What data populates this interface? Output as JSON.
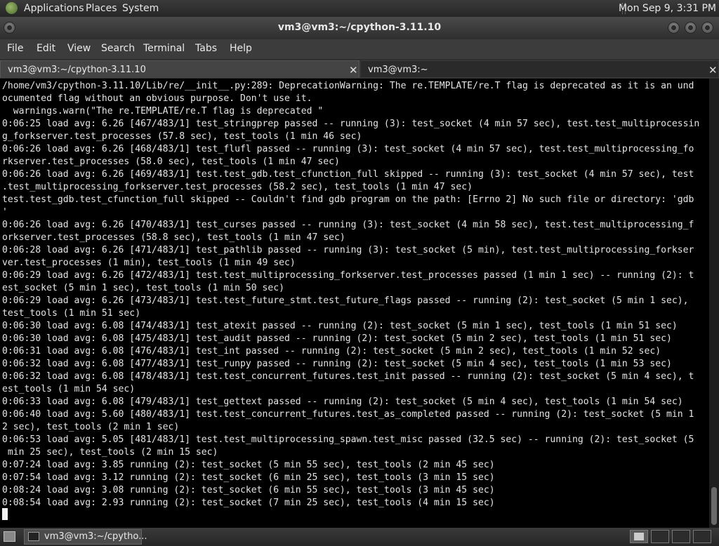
{
  "top_panel": {
    "menus": [
      "Applications",
      "Places",
      "System"
    ],
    "clock": "Mon Sep  9,  3:31 PM"
  },
  "window": {
    "title": "vm3@vm3:~/cpython-3.11.10"
  },
  "menubar": [
    "File",
    "Edit",
    "View",
    "Search",
    "Terminal",
    "Tabs",
    "Help"
  ],
  "tabs": [
    {
      "label": "vm3@vm3:~/cpython-3.11.10",
      "close": "✕"
    },
    {
      "label": "vm3@vm3:~",
      "close": "✕"
    }
  ],
  "terminal": {
    "lines": [
      "/home/vm3/cpython-3.11.10/Lib/re/__init__.py:289: DeprecationWarning: The re.TEMPLATE/re.T flag is deprecated as it is an und",
      "ocumented flag without an obvious purpose. Don't use it.",
      "  warnings.warn(\"The re.TEMPLATE/re.T flag is deprecated \"",
      "0:06:25 load avg: 6.26 [467/483/1] test_stringprep passed -- running (3): test_socket (4 min 57 sec), test.test_multiprocessin",
      "g_forkserver.test_processes (57.8 sec), test_tools (1 min 46 sec)",
      "0:06:26 load avg: 6.26 [468/483/1] test_flufl passed -- running (3): test_socket (4 min 57 sec), test.test_multiprocessing_fo",
      "rkserver.test_processes (58.0 sec), test_tools (1 min 47 sec)",
      "0:06:26 load avg: 6.26 [469/483/1] test.test_gdb.test_cfunction_full skipped -- running (3): test_socket (4 min 57 sec), test",
      ".test_multiprocessing_forkserver.test_processes (58.2 sec), test_tools (1 min 47 sec)",
      "test.test_gdb.test_cfunction_full skipped -- Couldn't find gdb program on the path: [Errno 2] No such file or directory: 'gdb",
      "'",
      "0:06:26 load avg: 6.26 [470/483/1] test_curses passed -- running (3): test_socket (4 min 58 sec), test.test_multiprocessing_f",
      "orkserver.test_processes (58.8 sec), test_tools (1 min 47 sec)",
      "0:06:28 load avg: 6.26 [471/483/1] test_pathlib passed -- running (3): test_socket (5 min), test.test_multiprocessing_forkser",
      "ver.test_processes (1 min), test_tools (1 min 49 sec)",
      "0:06:29 load avg: 6.26 [472/483/1] test.test_multiprocessing_forkserver.test_processes passed (1 min 1 sec) -- running (2): t",
      "est_socket (5 min 1 sec), test_tools (1 min 50 sec)",
      "0:06:29 load avg: 6.26 [473/483/1] test.test_future_stmt.test_future_flags passed -- running (2): test_socket (5 min 1 sec),",
      "test_tools (1 min 51 sec)",
      "0:06:30 load avg: 6.08 [474/483/1] test_atexit passed -- running (2): test_socket (5 min 1 sec), test_tools (1 min 51 sec)",
      "0:06:30 load avg: 6.08 [475/483/1] test_audit passed -- running (2): test_socket (5 min 2 sec), test_tools (1 min 51 sec)",
      "0:06:31 load avg: 6.08 [476/483/1] test_int passed -- running (2): test_socket (5 min 2 sec), test_tools (1 min 52 sec)",
      "0:06:32 load avg: 6.08 [477/483/1] test_runpy passed -- running (2): test_socket (5 min 4 sec), test_tools (1 min 53 sec)",
      "0:06:32 load avg: 6.08 [478/483/1] test.test_concurrent_futures.test_init passed -- running (2): test_socket (5 min 4 sec), t",
      "est_tools (1 min 54 sec)",
      "0:06:33 load avg: 6.08 [479/483/1] test_gettext passed -- running (2): test_socket (5 min 4 sec), test_tools (1 min 54 sec)",
      "0:06:40 load avg: 5.60 [480/483/1] test.test_concurrent_futures.test_as_completed passed -- running (2): test_socket (5 min 1",
      "2 sec), test_tools (2 min 1 sec)",
      "0:06:53 load avg: 5.05 [481/483/1] test.test_multiprocessing_spawn.test_misc passed (32.5 sec) -- running (2): test_socket (5",
      " min 25 sec), test_tools (2 min 15 sec)",
      "0:07:24 load avg: 3.85 running (2): test_socket (5 min 55 sec), test_tools (2 min 45 sec)",
      "0:07:54 load avg: 3.12 running (2): test_socket (6 min 25 sec), test_tools (3 min 15 sec)",
      "0:08:24 load avg: 3.08 running (2): test_socket (6 min 55 sec), test_tools (3 min 45 sec)",
      "0:08:54 load avg: 2.93 running (2): test_socket (7 min 25 sec), test_tools (4 min 15 sec)"
    ]
  },
  "taskbar": {
    "task_label": "vm3@vm3:~/cpytho..."
  }
}
